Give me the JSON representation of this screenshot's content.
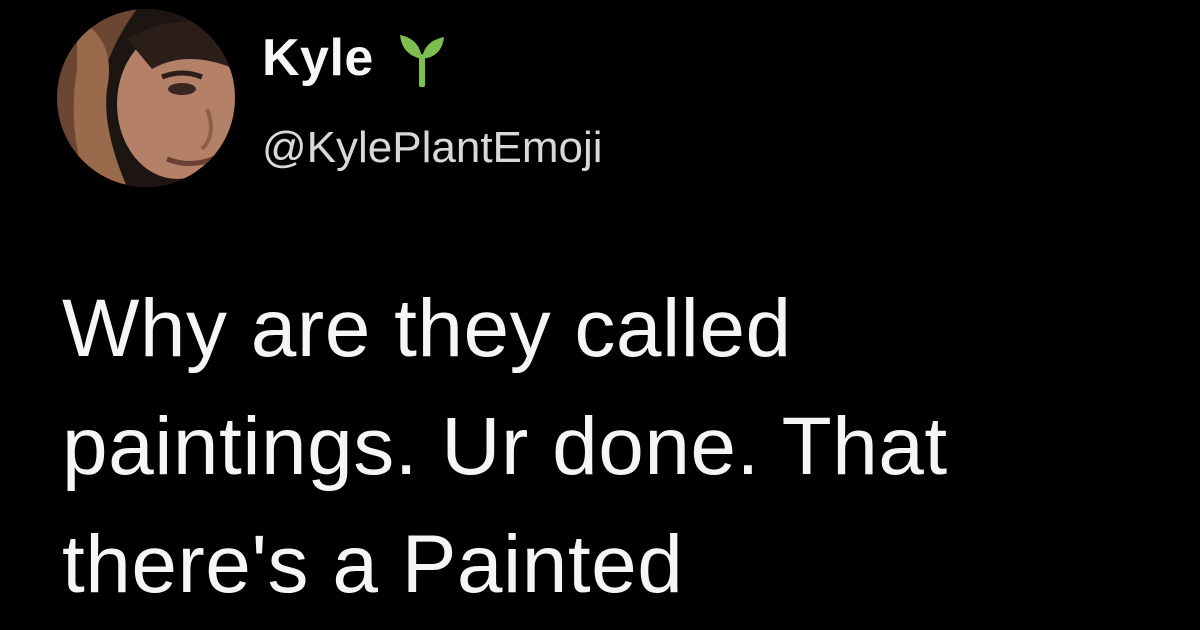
{
  "tweet": {
    "author": {
      "display_name": "Kyle",
      "name_emoji": "seedling-icon",
      "handle": "@KylePlantEmoji",
      "avatar": "profile-photo"
    },
    "text_lines": [
      "Why are they called",
      "paintings. Ur done. That",
      "there's a Painted"
    ]
  },
  "colors": {
    "background": "#000000",
    "text": "#f5f5f5",
    "handle_text": "#d8d8d8",
    "seedling": "#7cbf4f"
  }
}
